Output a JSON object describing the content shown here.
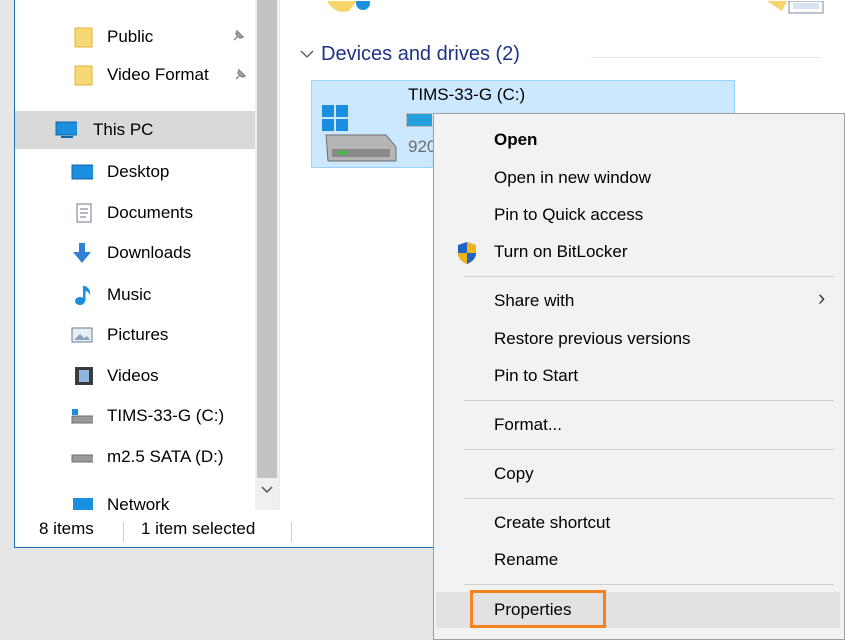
{
  "nav": {
    "items": [
      {
        "label": "Public",
        "icon": "folder-icon",
        "pinned": true
      },
      {
        "label": "Video Format",
        "icon": "folder-icon",
        "pinned": true
      },
      {
        "label": "This PC",
        "icon": "this-pc-icon",
        "selected": true
      },
      {
        "label": "Desktop",
        "icon": "desktop-icon"
      },
      {
        "label": "Documents",
        "icon": "documents-icon"
      },
      {
        "label": "Downloads",
        "icon": "downloads-icon"
      },
      {
        "label": "Music",
        "icon": "music-icon"
      },
      {
        "label": "Pictures",
        "icon": "pictures-icon"
      },
      {
        "label": "Videos",
        "icon": "videos-icon"
      },
      {
        "label": "TIMS-33-G (C:)",
        "icon": "drive-c-icon"
      },
      {
        "label": "m2.5 SATA (D:)",
        "icon": "drive-d-icon"
      },
      {
        "label": "Network",
        "icon": "network-icon"
      }
    ],
    "pin_glyph": "📌"
  },
  "status": {
    "items_count": "8 items",
    "selected": "1 item selected"
  },
  "content": {
    "section_title": "Devices and drives (2)",
    "drive": {
      "name": "TIMS-33-G (C:)",
      "space_text": "920",
      "used_fraction": 0.08
    }
  },
  "context_menu": {
    "items": [
      {
        "label": "Open",
        "bold": true
      },
      {
        "label": "Open in new window"
      },
      {
        "label": "Pin to Quick access"
      },
      {
        "label": "Turn on BitLocker",
        "icon": "shield-icon"
      },
      {
        "label": "Share with",
        "submenu": true
      },
      {
        "label": "Restore previous versions"
      },
      {
        "label": "Pin to Start"
      },
      {
        "label": "Format..."
      },
      {
        "label": "Copy"
      },
      {
        "label": "Create shortcut"
      },
      {
        "label": "Rename"
      },
      {
        "label": "Properties",
        "highlighted": true
      }
    ],
    "submenu_arrow": "›"
  },
  "colors": {
    "accent": "#1e6fb0",
    "selection": "#cce8ff",
    "highlight_outline": "#f5821f",
    "section_title": "#1e3287"
  }
}
